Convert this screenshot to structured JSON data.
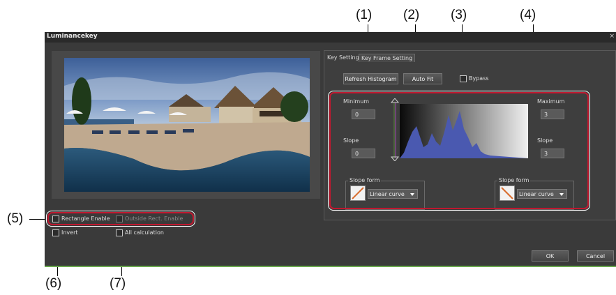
{
  "callouts": {
    "c1": "(1)",
    "c2": "(2)",
    "c3": "(3)",
    "c4": "(4)",
    "c5": "(5)",
    "c6": "(6)",
    "c7": "(7)"
  },
  "dialog": {
    "title": "Luminancekey",
    "close_glyph": "×"
  },
  "tabs": {
    "key_setting": "Key Setting",
    "key_frame_setting": "Key Frame Setting"
  },
  "buttons": {
    "refresh_histogram": "Refresh Histogram",
    "auto_fit": "Auto Fit",
    "ok": "OK",
    "cancel": "Cancel"
  },
  "bypass_label": "Bypass",
  "left": {
    "minimum_label": "Minimum",
    "minimum_value": "0",
    "slope_label": "Slope",
    "slope_value": "0",
    "slope_form_label": "Slope form",
    "slope_form_value": "Linear curve"
  },
  "right": {
    "maximum_label": "Maximum",
    "maximum_value": "3",
    "slope_label": "Slope",
    "slope_value": "3",
    "slope_form_label": "Slope form",
    "slope_form_value": "Linear curve"
  },
  "options": {
    "rectangle_enable": "Rectangle Enable",
    "outside_rect_enable": "Outside Rect. Enable",
    "invert": "Invert",
    "all_calculation": "All calculation"
  },
  "colors": {
    "highlight": "#c0182f",
    "histogram": "#4a59b0",
    "dialog_bg": "#3a3a3a"
  }
}
